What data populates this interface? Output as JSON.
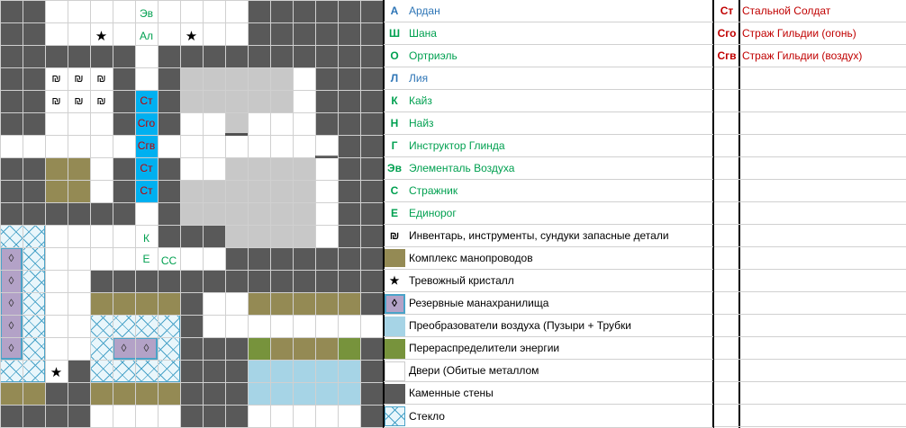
{
  "map": {
    "labels": {
      "elemental": "Эв",
      "ardan_lia": "Ал",
      "guard_1": "Ст",
      "guard_fire": "Сго",
      "guard_air": "Сгв",
      "guard_2": "Ст",
      "guard_3": "Ст",
      "kayz": "К",
      "unicorn": "Е",
      "guards_cc": "СС"
    },
    "star_symbol": "★",
    "inventory_symbol": "₪",
    "crystal_symbol": "◊"
  },
  "legend": {
    "items": [
      {
        "code": "А",
        "label": "Ардан",
        "color": "#2e75b6"
      },
      {
        "code": "Ш",
        "label": "Шана",
        "color": "#00a050"
      },
      {
        "code": "О",
        "label": "Ортриэль",
        "color": "#00a050"
      },
      {
        "code": "Л",
        "label": "Лия",
        "color": "#2e75b6"
      },
      {
        "code": "К",
        "label": "Кайз",
        "color": "#00a050"
      },
      {
        "code": "Н",
        "label": "Найз",
        "color": "#00a050"
      },
      {
        "code": "Г",
        "label": "Инструктор Глинда",
        "color": "#00a050"
      },
      {
        "code": "Эв",
        "label": "Элементаль Воздуха",
        "color": "#00a050"
      },
      {
        "code": "С",
        "label": "Стражник",
        "color": "#00a050"
      },
      {
        "code": "Е",
        "label": "Единорог",
        "color": "#00a050"
      },
      {
        "code": "₪",
        "label": "Инвентарь, инструменты, сундуки запасные детали",
        "color": "#000000"
      },
      {
        "code": "",
        "label": "Комплекс манопроводов",
        "color": "#000000"
      },
      {
        "code": "★",
        "label": "Тревожный кристалл",
        "color": "#000000"
      },
      {
        "code": "◊",
        "label": "Резервные манахранилища",
        "color": "#000000"
      },
      {
        "code": "",
        "label": "Преобразователи воздуха (Пузыри + Трубки",
        "color": "#000000"
      },
      {
        "code": "",
        "label": "Перераспределители энергии",
        "color": "#000000"
      },
      {
        "code": "",
        "label": "Двери (Обитые металлом",
        "color": "#000000"
      },
      {
        "code": "",
        "label": "Каменные стены",
        "color": "#000000"
      },
      {
        "code": "",
        "label": "Стекло",
        "color": "#000000"
      }
    ],
    "enemies": [
      {
        "code": "Ст",
        "label": "Стальной Солдат"
      },
      {
        "code": "Сго",
        "label": "Страж Гильдии (огонь)"
      },
      {
        "code": "Сгв",
        "label": "Страж Гильдии (воздух)"
      }
    ]
  },
  "colors": {
    "stone": "#595959",
    "pipes": "#948a54",
    "energy": "#77933c",
    "air": "#a6d4e6",
    "glass": "#4aa3c8",
    "storage": "#b3a2c7",
    "corridor_highlight": "#00b0f0",
    "enemy_text": "#c00000",
    "ally_text": "#00a050"
  }
}
